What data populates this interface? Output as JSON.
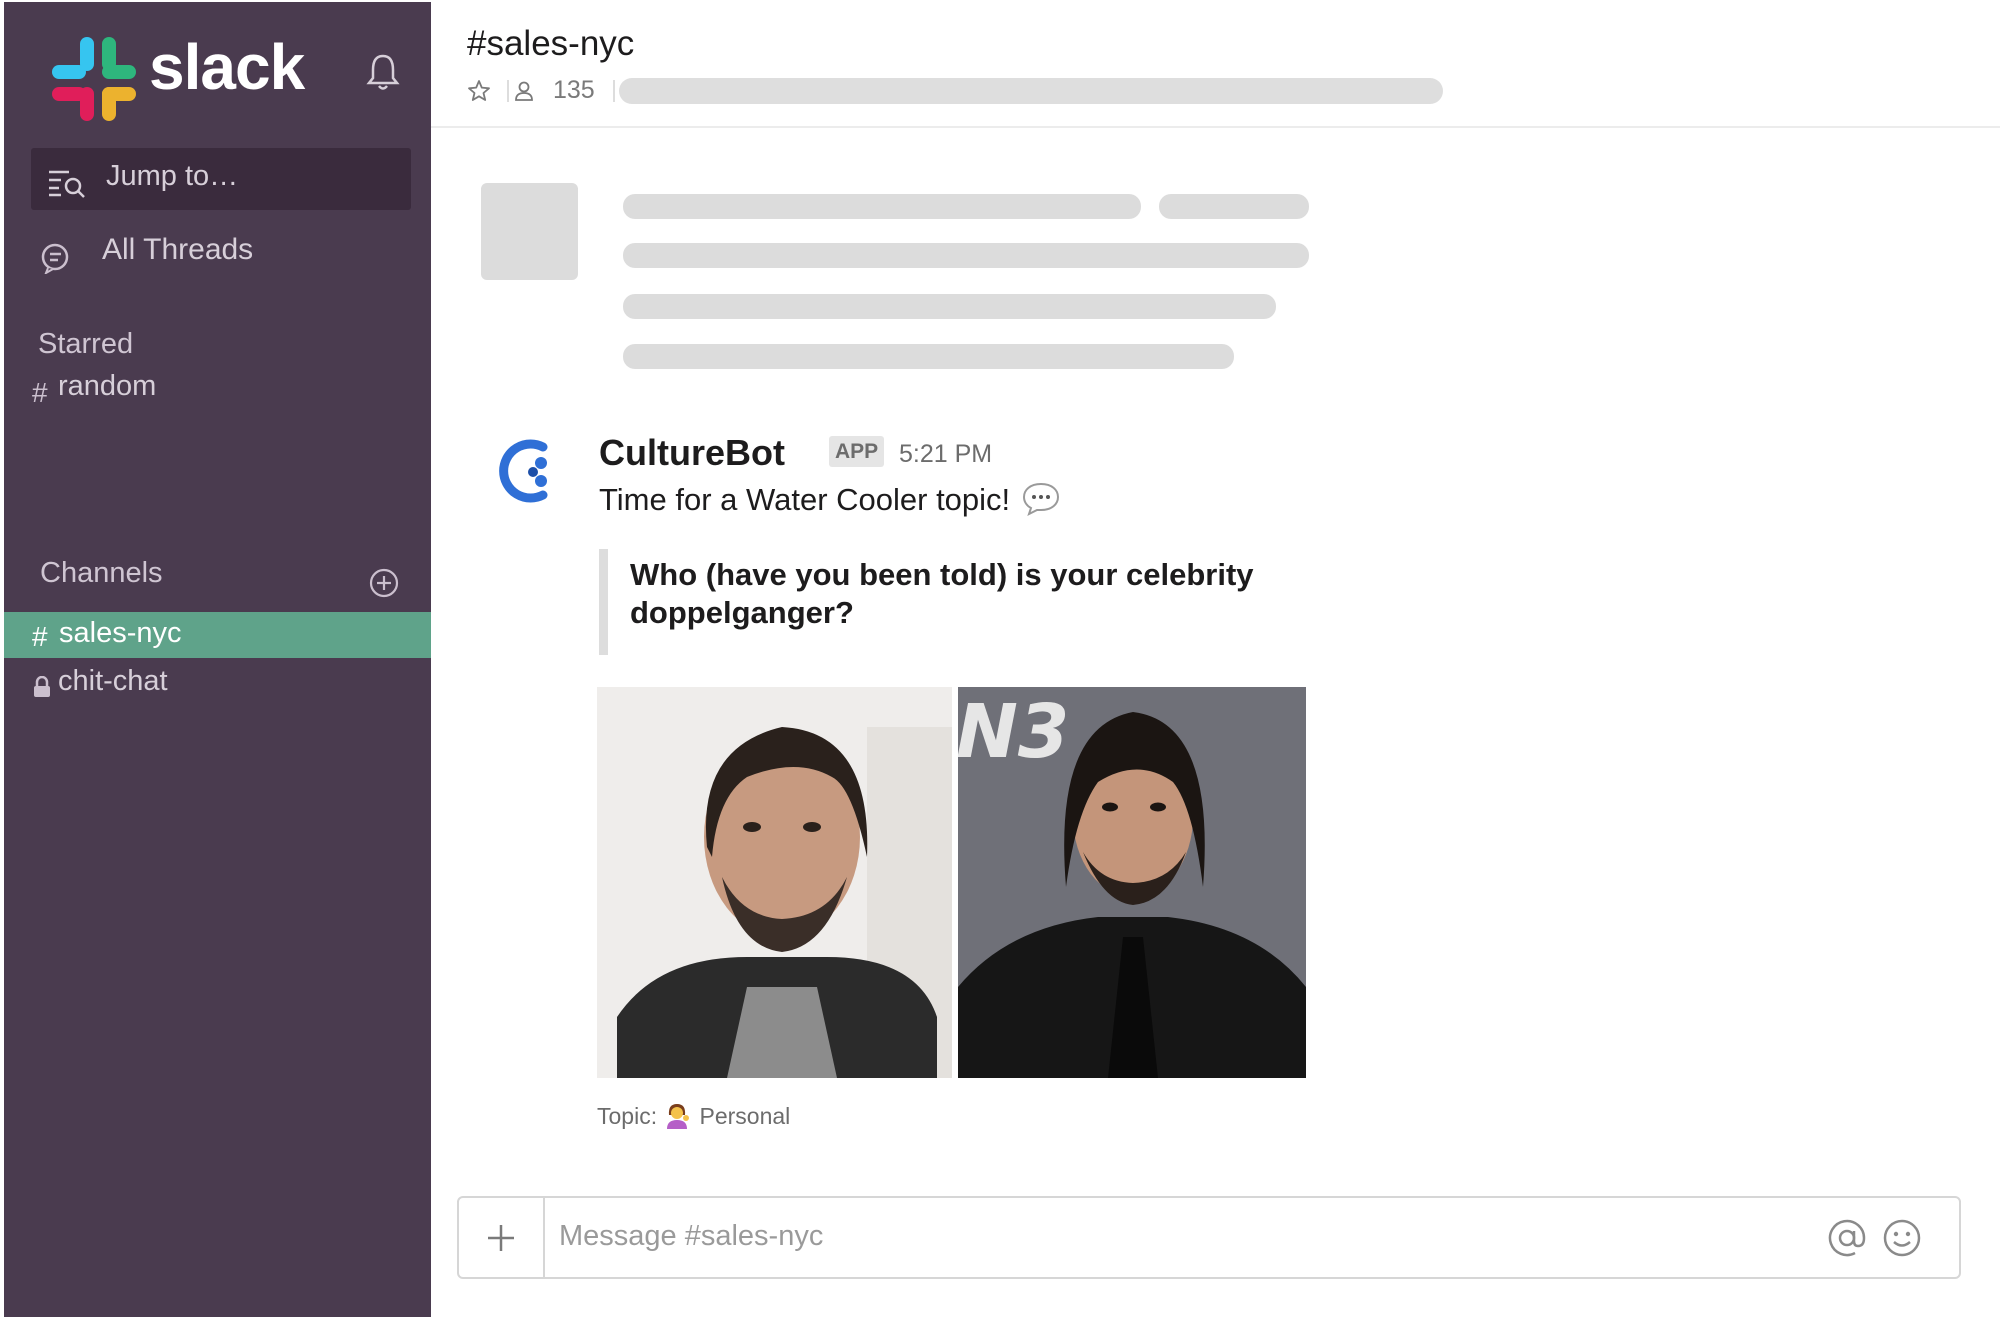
{
  "app": {
    "brand": "slack",
    "accent_color": "#4a3b4f",
    "active_item_color": "#5fa38a"
  },
  "sidebar": {
    "jump_to": "Jump to…",
    "all_threads": "All Threads",
    "starred_label": "Starred",
    "starred_items": [
      {
        "glyph": "#",
        "label": "random"
      }
    ],
    "channels_label": "Channels",
    "channels": [
      {
        "glyph": "#",
        "label": "sales-nyc",
        "active": true
      },
      {
        "glyph": "lock-icon",
        "label": "chit-chat",
        "active": false
      }
    ]
  },
  "header": {
    "channel_title": "#sales-nyc",
    "member_count": "135"
  },
  "message": {
    "author": "CultureBot",
    "badge": "APP",
    "time": "5:21 PM",
    "text": "Time for a Water Cooler topic!",
    "quote": "Who (have you been told) is your celebrity doppelganger?",
    "topic_prefix": "Topic:",
    "topic_value": "Personal",
    "photo_right_caption_fragment": "N3"
  },
  "composer": {
    "placeholder": "Message #sales-nyc"
  }
}
